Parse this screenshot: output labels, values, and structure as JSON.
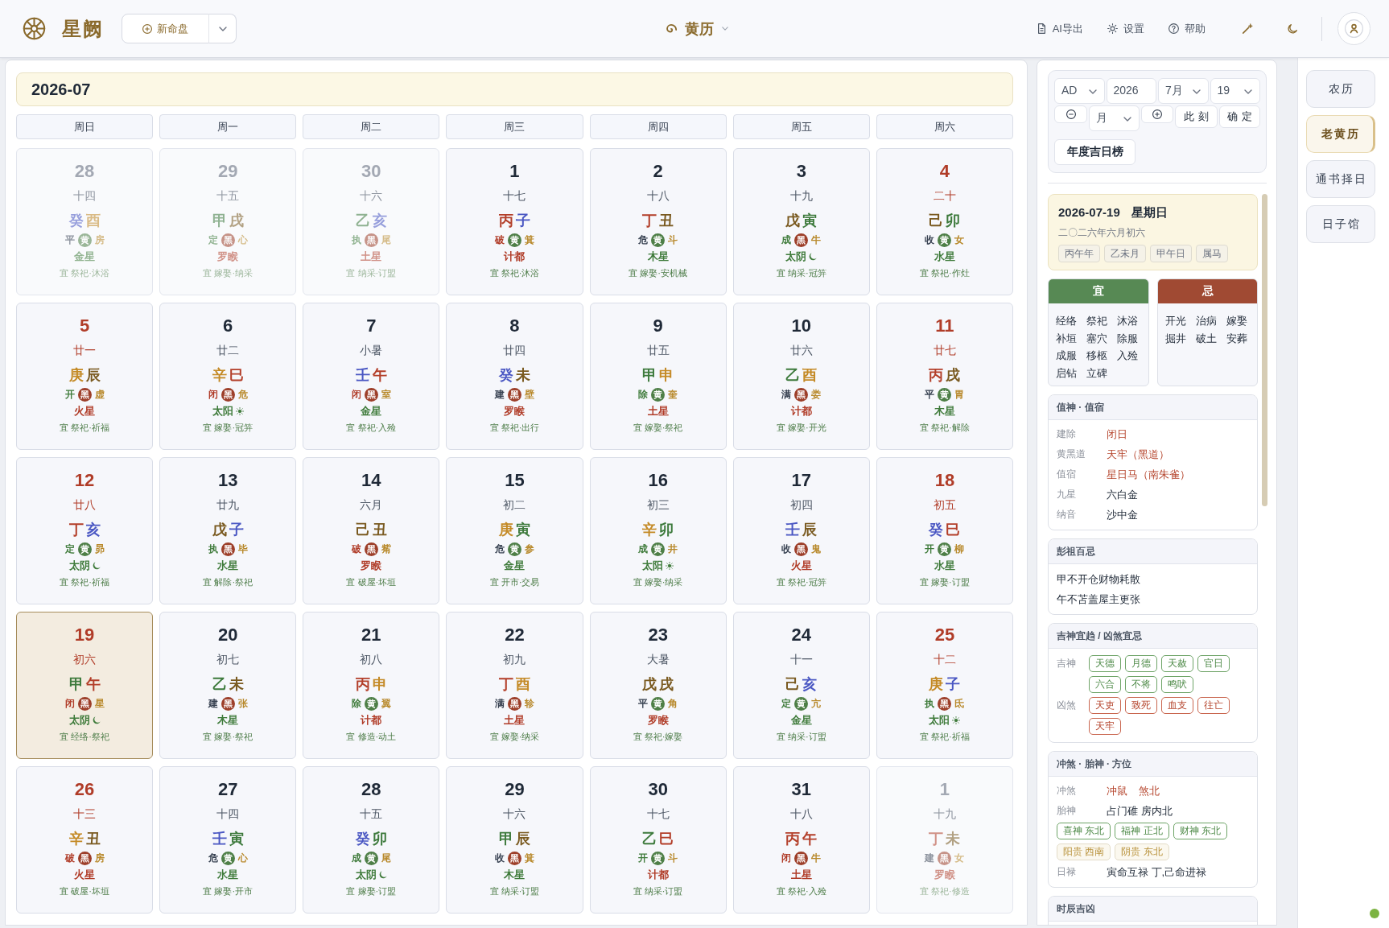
{
  "app_bar": {
    "app_name": "星阙",
    "new_chart_button": "新命盘",
    "view_title": "黄历",
    "actions": [
      "AI导出",
      "设置",
      "帮助"
    ]
  },
  "calendar": {
    "month_title": "2026-07",
    "weekdays": [
      "周日",
      "周一",
      "周二",
      "周三",
      "周四",
      "周五",
      "周六"
    ],
    "days": [
      {
        "day": "28",
        "lunar": "十四",
        "kind": "other",
        "selected": false,
        "stem": {
          "text": "癸",
          "color": "#979fdc"
        },
        "branch": {
          "text": "酉",
          "color": "#dabb86"
        },
        "officer": {
          "text": "平",
          "color": "#8d939e"
        },
        "path": {
          "text": "黄",
          "kind": "yellow"
        },
        "mansion": "房",
        "star": {
          "text": "金星",
          "lucky": true
        },
        "yi": "宜 祭祀·沐浴"
      },
      {
        "day": "29",
        "lunar": "十五",
        "kind": "other",
        "selected": false,
        "stem": {
          "text": "甲",
          "color": "#90b292"
        },
        "branch": {
          "text": "戌",
          "color": "#b2a183"
        },
        "officer": {
          "text": "定",
          "color": "#91b391"
        },
        "path": {
          "text": "黑",
          "kind": "black"
        },
        "mansion": "心",
        "star": {
          "text": "罗睺",
          "lucky": false
        },
        "yi": "宜 嫁娶·纳采"
      },
      {
        "day": "30",
        "lunar": "十六",
        "kind": "other",
        "selected": false,
        "stem": {
          "text": "乙",
          "color": "#90b292"
        },
        "branch": {
          "text": "亥",
          "color": "#979fdc"
        },
        "officer": {
          "text": "执",
          "color": "#91b391"
        },
        "path": {
          "text": "黑",
          "kind": "black"
        },
        "mansion": "尾",
        "star": {
          "text": "土星",
          "lucky": false
        },
        "yi": "宜 纳采·订盟"
      },
      {
        "day": "1",
        "lunar": "十七",
        "kind": "current",
        "selected": false,
        "stem": {
          "text": "丙",
          "color": "#b33f2a"
        },
        "branch": {
          "text": "子",
          "color": "#4a57c3"
        },
        "officer": {
          "text": "破",
          "color": "#b03c28"
        },
        "path": {
          "text": "黄",
          "kind": "yellow"
        },
        "mansion": "箕",
        "star": {
          "text": "计都",
          "lucky": false
        },
        "yi": "宜 祭祀·沐浴"
      },
      {
        "day": "2",
        "lunar": "十八",
        "kind": "current",
        "selected": false,
        "stem": {
          "text": "丁",
          "color": "#b33f2a"
        },
        "branch": {
          "text": "丑",
          "color": "#7a5a20"
        },
        "officer": {
          "text": "危",
          "color": "#374151"
        },
        "path": {
          "text": "黄",
          "kind": "yellow"
        },
        "mansion": "斗",
        "star": {
          "text": "木星",
          "lucky": true
        },
        "yi": "宜 嫁娶·安机械"
      },
      {
        "day": "3",
        "lunar": "十九",
        "kind": "current",
        "selected": false,
        "stem": {
          "text": "戊",
          "color": "#7a5a20"
        },
        "branch": {
          "text": "寅",
          "color": "#3d7a3c"
        },
        "officer": {
          "text": "成",
          "color": "#3f7b3b"
        },
        "path": {
          "text": "黑",
          "kind": "black"
        },
        "mansion": "牛",
        "star": {
          "text": "太阴",
          "lucky": true,
          "kind": "moon"
        },
        "yi": "宜 纳采·冠笄"
      },
      {
        "day": "4",
        "lunar": "二十",
        "kind": "weekend",
        "selected": false,
        "stem": {
          "text": "己",
          "color": "#7a5a20"
        },
        "branch": {
          "text": "卯",
          "color": "#3d7a3c"
        },
        "officer": {
          "text": "收",
          "color": "#374151"
        },
        "path": {
          "text": "黄",
          "kind": "yellow"
        },
        "mansion": "女",
        "star": {
          "text": "水星",
          "lucky": true
        },
        "yi": "宜 祭祀·作灶"
      },
      {
        "day": "5",
        "lunar": "廿一",
        "kind": "weekend",
        "selected": false,
        "stem": {
          "text": "庚",
          "color": "#c48a26"
        },
        "branch": {
          "text": "辰",
          "color": "#7a5a20"
        },
        "officer": {
          "text": "开",
          "color": "#3f7b3b"
        },
        "path": {
          "text": "黑",
          "kind": "black"
        },
        "mansion": "虚",
        "star": {
          "text": "火星",
          "lucky": false
        },
        "yi": "宜 祭祀·祈福"
      },
      {
        "day": "6",
        "lunar": "廿二",
        "kind": "current",
        "selected": false,
        "stem": {
          "text": "辛",
          "color": "#c48a26"
        },
        "branch": {
          "text": "巳",
          "color": "#b33f2a"
        },
        "officer": {
          "text": "闭",
          "color": "#b03c28"
        },
        "path": {
          "text": "黑",
          "kind": "black"
        },
        "mansion": "危",
        "star": {
          "text": "太阳",
          "lucky": true,
          "kind": "sun"
        },
        "yi": "宜 嫁娶·冠笄"
      },
      {
        "day": "7",
        "lunar": "小暑",
        "kind": "current",
        "selected": false,
        "stem": {
          "text": "壬",
          "color": "#4a57c3"
        },
        "branch": {
          "text": "午",
          "color": "#b33f2a"
        },
        "officer": {
          "text": "闭",
          "color": "#b03c28"
        },
        "path": {
          "text": "黑",
          "kind": "black"
        },
        "mansion": "室",
        "star": {
          "text": "金星",
          "lucky": true
        },
        "yi": "宜 祭祀·入殓"
      },
      {
        "day": "8",
        "lunar": "廿四",
        "kind": "current",
        "selected": false,
        "stem": {
          "text": "癸",
          "color": "#4a57c3"
        },
        "branch": {
          "text": "未",
          "color": "#7a5a20"
        },
        "officer": {
          "text": "建",
          "color": "#374151"
        },
        "path": {
          "text": "黑",
          "kind": "black"
        },
        "mansion": "壁",
        "star": {
          "text": "罗睺",
          "lucky": false
        },
        "yi": "宜 祭祀·出行"
      },
      {
        "day": "9",
        "lunar": "廿五",
        "kind": "current",
        "selected": false,
        "stem": {
          "text": "甲",
          "color": "#3d7a3c"
        },
        "branch": {
          "text": "申",
          "color": "#c48a26"
        },
        "officer": {
          "text": "除",
          "color": "#3f7b3b"
        },
        "path": {
          "text": "黄",
          "kind": "yellow"
        },
        "mansion": "奎",
        "star": {
          "text": "土星",
          "lucky": false
        },
        "yi": "宜 嫁娶·祭祀"
      },
      {
        "day": "10",
        "lunar": "廿六",
        "kind": "current",
        "selected": false,
        "stem": {
          "text": "乙",
          "color": "#3d7a3c"
        },
        "branch": {
          "text": "酉",
          "color": "#c48a26"
        },
        "officer": {
          "text": "满",
          "color": "#374151"
        },
        "path": {
          "text": "黑",
          "kind": "black"
        },
        "mansion": "娄",
        "star": {
          "text": "计都",
          "lucky": false
        },
        "yi": "宜 嫁娶·开光"
      },
      {
        "day": "11",
        "lunar": "廿七",
        "kind": "weekend",
        "selected": false,
        "stem": {
          "text": "丙",
          "color": "#b33f2a"
        },
        "branch": {
          "text": "戌",
          "color": "#7a5a20"
        },
        "officer": {
          "text": "平",
          "color": "#374151"
        },
        "path": {
          "text": "黄",
          "kind": "yellow"
        },
        "mansion": "胃",
        "star": {
          "text": "木星",
          "lucky": true
        },
        "yi": "宜 祭祀·解除"
      },
      {
        "day": "12",
        "lunar": "廿八",
        "kind": "weekend",
        "selected": false,
        "stem": {
          "text": "丁",
          "color": "#b33f2a"
        },
        "branch": {
          "text": "亥",
          "color": "#4a57c3"
        },
        "officer": {
          "text": "定",
          "color": "#3f7b3b"
        },
        "path": {
          "text": "黄",
          "kind": "yellow"
        },
        "mansion": "昴",
        "star": {
          "text": "太阴",
          "lucky": true,
          "kind": "moon"
        },
        "yi": "宜 祭祀·祈福"
      },
      {
        "day": "13",
        "lunar": "廿九",
        "kind": "current",
        "selected": false,
        "stem": {
          "text": "戊",
          "color": "#7a5a20"
        },
        "branch": {
          "text": "子",
          "color": "#4a57c3"
        },
        "officer": {
          "text": "执",
          "color": "#3f7b3b"
        },
        "path": {
          "text": "黑",
          "kind": "black"
        },
        "mansion": "毕",
        "star": {
          "text": "水星",
          "lucky": true
        },
        "yi": "宜 解除·祭祀"
      },
      {
        "day": "14",
        "lunar": "六月",
        "kind": "current",
        "selected": false,
        "stem": {
          "text": "己",
          "color": "#7a5a20"
        },
        "branch": {
          "text": "丑",
          "color": "#7a5a20"
        },
        "officer": {
          "text": "破",
          "color": "#b03c28"
        },
        "path": {
          "text": "黑",
          "kind": "black"
        },
        "mansion": "觜",
        "star": {
          "text": "罗睺",
          "lucky": false
        },
        "yi": "宜 破屋·坏垣"
      },
      {
        "day": "15",
        "lunar": "初二",
        "kind": "current",
        "selected": false,
        "stem": {
          "text": "庚",
          "color": "#c48a26"
        },
        "branch": {
          "text": "寅",
          "color": "#3d7a3c"
        },
        "officer": {
          "text": "危",
          "color": "#374151"
        },
        "path": {
          "text": "黄",
          "kind": "yellow"
        },
        "mansion": "参",
        "star": {
          "text": "金星",
          "lucky": true
        },
        "yi": "宜 开市·交易"
      },
      {
        "day": "16",
        "lunar": "初三",
        "kind": "current",
        "selected": false,
        "stem": {
          "text": "辛",
          "color": "#c48a26"
        },
        "branch": {
          "text": "卯",
          "color": "#3d7a3c"
        },
        "officer": {
          "text": "成",
          "color": "#3f7b3b"
        },
        "path": {
          "text": "黄",
          "kind": "yellow"
        },
        "mansion": "井",
        "star": {
          "text": "太阳",
          "lucky": true,
          "kind": "sun"
        },
        "yi": "宜 嫁娶·纳采"
      },
      {
        "day": "17",
        "lunar": "初四",
        "kind": "current",
        "selected": false,
        "stem": {
          "text": "壬",
          "color": "#4a57c3"
        },
        "branch": {
          "text": "辰",
          "color": "#7a5a20"
        },
        "officer": {
          "text": "收",
          "color": "#374151"
        },
        "path": {
          "text": "黑",
          "kind": "black"
        },
        "mansion": "鬼",
        "star": {
          "text": "火星",
          "lucky": false
        },
        "yi": "宜 祭祀·冠笄"
      },
      {
        "day": "18",
        "lunar": "初五",
        "kind": "weekend",
        "selected": false,
        "stem": {
          "text": "癸",
          "color": "#4a57c3"
        },
        "branch": {
          "text": "巳",
          "color": "#b33f2a"
        },
        "officer": {
          "text": "开",
          "color": "#3f7b3b"
        },
        "path": {
          "text": "黄",
          "kind": "yellow"
        },
        "mansion": "柳",
        "star": {
          "text": "水星",
          "lucky": true
        },
        "yi": "宜 嫁娶·订盟"
      },
      {
        "day": "19",
        "lunar": "初六",
        "kind": "weekend",
        "selected": true,
        "stem": {
          "text": "甲",
          "color": "#3d7a3c"
        },
        "branch": {
          "text": "午",
          "color": "#b33f2a"
        },
        "officer": {
          "text": "闭",
          "color": "#b03c28"
        },
        "path": {
          "text": "黑",
          "kind": "black"
        },
        "mansion": "星",
        "star": {
          "text": "太阴",
          "lucky": true,
          "kind": "moon"
        },
        "yi": "宜 经络·祭祀"
      },
      {
        "day": "20",
        "lunar": "初七",
        "kind": "current",
        "selected": false,
        "stem": {
          "text": "乙",
          "color": "#3d7a3c"
        },
        "branch": {
          "text": "未",
          "color": "#7a5a20"
        },
        "officer": {
          "text": "建",
          "color": "#374151"
        },
        "path": {
          "text": "黑",
          "kind": "black"
        },
        "mansion": "张",
        "star": {
          "text": "木星",
          "lucky": true
        },
        "yi": "宜 嫁娶·祭祀"
      },
      {
        "day": "21",
        "lunar": "初八",
        "kind": "current",
        "selected": false,
        "stem": {
          "text": "丙",
          "color": "#b33f2a"
        },
        "branch": {
          "text": "申",
          "color": "#c48a26"
        },
        "officer": {
          "text": "除",
          "color": "#3f7b3b"
        },
        "path": {
          "text": "黄",
          "kind": "yellow"
        },
        "mansion": "翼",
        "star": {
          "text": "计都",
          "lucky": false
        },
        "yi": "宜 修造·动土"
      },
      {
        "day": "22",
        "lunar": "初九",
        "kind": "current",
        "selected": false,
        "stem": {
          "text": "丁",
          "color": "#b33f2a"
        },
        "branch": {
          "text": "酉",
          "color": "#c48a26"
        },
        "officer": {
          "text": "满",
          "color": "#374151"
        },
        "path": {
          "text": "黑",
          "kind": "black"
        },
        "mansion": "轸",
        "star": {
          "text": "土星",
          "lucky": false
        },
        "yi": "宜 嫁娶·纳采"
      },
      {
        "day": "23",
        "lunar": "大暑",
        "kind": "current",
        "selected": false,
        "stem": {
          "text": "戊",
          "color": "#7a5a20"
        },
        "branch": {
          "text": "戌",
          "color": "#7a5a20"
        },
        "officer": {
          "text": "平",
          "color": "#374151"
        },
        "path": {
          "text": "黄",
          "kind": "yellow"
        },
        "mansion": "角",
        "star": {
          "text": "罗睺",
          "lucky": false
        },
        "yi": "宜 祭祀·嫁娶"
      },
      {
        "day": "24",
        "lunar": "十一",
        "kind": "current",
        "selected": false,
        "stem": {
          "text": "己",
          "color": "#7a5a20"
        },
        "branch": {
          "text": "亥",
          "color": "#4a57c3"
        },
        "officer": {
          "text": "定",
          "color": "#3f7b3b"
        },
        "path": {
          "text": "黄",
          "kind": "yellow"
        },
        "mansion": "亢",
        "star": {
          "text": "金星",
          "lucky": true
        },
        "yi": "宜 纳采·订盟"
      },
      {
        "day": "25",
        "lunar": "十二",
        "kind": "weekend",
        "selected": false,
        "stem": {
          "text": "庚",
          "color": "#c48a26"
        },
        "branch": {
          "text": "子",
          "color": "#4a57c3"
        },
        "officer": {
          "text": "执",
          "color": "#3f7b3b"
        },
        "path": {
          "text": "黑",
          "kind": "black"
        },
        "mansion": "氐",
        "star": {
          "text": "太阳",
          "lucky": true,
          "kind": "sun"
        },
        "yi": "宜 祭祀·祈福"
      },
      {
        "day": "26",
        "lunar": "十三",
        "kind": "weekend",
        "selected": false,
        "stem": {
          "text": "辛",
          "color": "#c48a26"
        },
        "branch": {
          "text": "丑",
          "color": "#7a5a20"
        },
        "officer": {
          "text": "破",
          "color": "#b03c28"
        },
        "path": {
          "text": "黑",
          "kind": "black"
        },
        "mansion": "房",
        "star": {
          "text": "火星",
          "lucky": false
        },
        "yi": "宜 破屋·坏垣"
      },
      {
        "day": "27",
        "lunar": "十四",
        "kind": "current",
        "selected": false,
        "stem": {
          "text": "壬",
          "color": "#4a57c3"
        },
        "branch": {
          "text": "寅",
          "color": "#3d7a3c"
        },
        "officer": {
          "text": "危",
          "color": "#374151"
        },
        "path": {
          "text": "黄",
          "kind": "yellow"
        },
        "mansion": "心",
        "star": {
          "text": "水星",
          "lucky": true
        },
        "yi": "宜 嫁娶·开市"
      },
      {
        "day": "28",
        "lunar": "十五",
        "kind": "current",
        "selected": false,
        "stem": {
          "text": "癸",
          "color": "#4a57c3"
        },
        "branch": {
          "text": "卯",
          "color": "#3d7a3c"
        },
        "officer": {
          "text": "成",
          "color": "#3f7b3b"
        },
        "path": {
          "text": "黄",
          "kind": "yellow"
        },
        "mansion": "尾",
        "star": {
          "text": "太阴",
          "lucky": true,
          "kind": "moon"
        },
        "yi": "宜 嫁娶·订盟"
      },
      {
        "day": "29",
        "lunar": "十六",
        "kind": "current",
        "selected": false,
        "stem": {
          "text": "甲",
          "color": "#3d7a3c"
        },
        "branch": {
          "text": "辰",
          "color": "#7a5a20"
        },
        "officer": {
          "text": "收",
          "color": "#374151"
        },
        "path": {
          "text": "黑",
          "kind": "black"
        },
        "mansion": "箕",
        "star": {
          "text": "木星",
          "lucky": true
        },
        "yi": "宜 纳采·订盟"
      },
      {
        "day": "30",
        "lunar": "十七",
        "kind": "current",
        "selected": false,
        "stem": {
          "text": "乙",
          "color": "#3d7a3c"
        },
        "branch": {
          "text": "巳",
          "color": "#b33f2a"
        },
        "officer": {
          "text": "开",
          "color": "#3f7b3b"
        },
        "path": {
          "text": "黄",
          "kind": "yellow"
        },
        "mansion": "斗",
        "star": {
          "text": "计都",
          "lucky": false
        },
        "yi": "宜 纳采·订盟"
      },
      {
        "day": "31",
        "lunar": "十八",
        "kind": "current",
        "selected": false,
        "stem": {
          "text": "丙",
          "color": "#b33f2a"
        },
        "branch": {
          "text": "午",
          "color": "#b33f2a"
        },
        "officer": {
          "text": "闭",
          "color": "#b03c28"
        },
        "path": {
          "text": "黑",
          "kind": "black"
        },
        "mansion": "牛",
        "star": {
          "text": "土星",
          "lucky": false
        },
        "yi": "宜 祭祀·入殓"
      },
      {
        "day": "1",
        "lunar": "十九",
        "kind": "other",
        "selected": false,
        "stem": {
          "text": "丁",
          "color": "#d19288"
        },
        "branch": {
          "text": "未",
          "color": "#b2a183"
        },
        "officer": {
          "text": "建",
          "color": "#8d939e"
        },
        "path": {
          "text": "黑",
          "kind": "black"
        },
        "mansion": "女",
        "star": {
          "text": "罗睺",
          "lucky": false
        },
        "yi": "宜 祭祀·修造"
      }
    ]
  },
  "date_picker": {
    "era": "AD",
    "year": "2026",
    "month": "7月",
    "day": "19",
    "step_unit": "月",
    "now_button": "此刻",
    "confirm_button": "确定",
    "ranking_button": "年度吉日榜"
  },
  "day_detail": {
    "date": "2026-07-19",
    "weekday": "星期日",
    "lunar_date": "二〇二六年六月初六",
    "tags": [
      "丙午年",
      "乙未月",
      "甲午日",
      "属马"
    ]
  },
  "yi": {
    "title": "宜",
    "items": [
      "经络",
      "祭祀",
      "沐浴",
      "补垣",
      "塞穴",
      "除服",
      "成服",
      "移柩",
      "入殓",
      "启钻",
      "立碑"
    ]
  },
  "ji": {
    "title": "忌",
    "items": [
      "开光",
      "治病",
      "嫁娶",
      "掘井",
      "破土",
      "安葬"
    ]
  },
  "duty_card": {
    "title": "值神 · 值宿",
    "rows": [
      {
        "label": "建除",
        "value": "闭日",
        "alert": true
      },
      {
        "label": "黄黑道",
        "value": "天牢（黑道）",
        "alert": true
      },
      {
        "label": "值宿",
        "value": "星日马（南朱雀）",
        "alert": true
      },
      {
        "label": "九星",
        "value": "六白金",
        "alert": false
      },
      {
        "label": "纳音",
        "value": "沙中金",
        "alert": false
      }
    ]
  },
  "pengzu_card": {
    "title": "彭祖百忌",
    "lines": [
      "甲不开仓财物耗散",
      "午不苫盖屋主更张"
    ]
  },
  "spirits_card": {
    "title": "吉神宜趋 / 凶煞宜忌",
    "groups": [
      {
        "label": "吉神",
        "kind": "good",
        "items": [
          "天德",
          "月德",
          "天赦",
          "官日",
          "六合",
          "不将",
          "鸣吠"
        ]
      },
      {
        "label": "凶煞",
        "kind": "bad",
        "items": [
          "天吏",
          "致死",
          "血支",
          "往亡",
          "天牢"
        ]
      }
    ]
  },
  "direction_card": {
    "title": "冲煞 · 胎神 · 方位",
    "clash": {
      "label": "冲煞",
      "values": [
        "冲鼠",
        "煞北"
      ]
    },
    "fetal_god": {
      "label": "胎神",
      "value": "占门碓 房内北"
    },
    "gods": [
      {
        "text": "喜神 东北",
        "kind": "lucky"
      },
      {
        "text": "福神 正北",
        "kind": "lucky"
      },
      {
        "text": "财神 东北",
        "kind": "lucky"
      },
      {
        "text": "阳贵 西南",
        "kind": "noble"
      },
      {
        "text": "阴贵 东北",
        "kind": "noble"
      }
    ],
    "daily_lu": {
      "label": "日禄",
      "value": "寅命互禄 丁,己命进禄"
    }
  },
  "hours_card": {
    "title": "时辰吉凶"
  },
  "nav": [
    {
      "label": "农历",
      "selected": false
    },
    {
      "label": "老黄历",
      "selected": true
    },
    {
      "label": "通书择日",
      "selected": false
    },
    {
      "label": "日子馆",
      "selected": false
    }
  ]
}
